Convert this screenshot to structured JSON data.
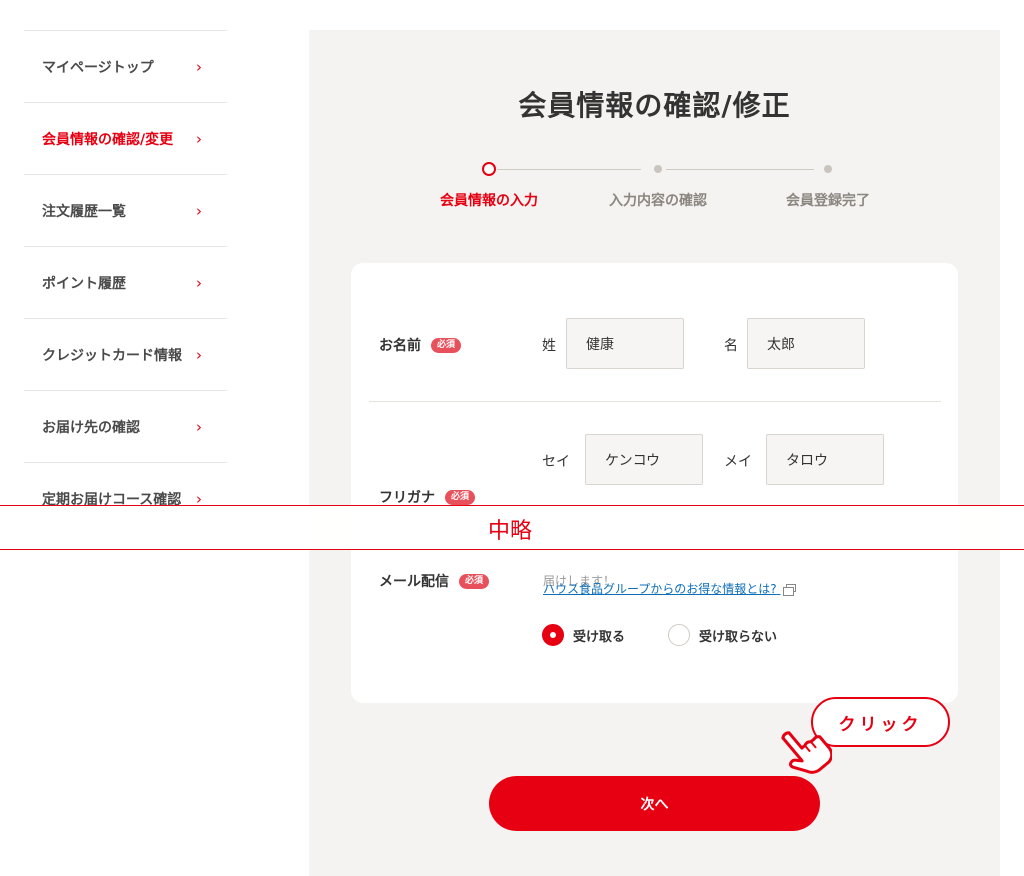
{
  "sidebar": {
    "items": [
      {
        "label": "マイページトップ",
        "active": false
      },
      {
        "label": "会員情報の確認/変更",
        "active": true
      },
      {
        "label": "注文履歴一覧",
        "active": false
      },
      {
        "label": "ポイント履歴",
        "active": false
      },
      {
        "label": "クレジットカード情報",
        "active": false
      },
      {
        "label": "お届け先の確認",
        "active": false
      },
      {
        "label": "定期お届けコース確認",
        "active": false
      }
    ],
    "chevron": "›"
  },
  "main": {
    "title": "会員情報の確認/修正",
    "steps": [
      {
        "label": "会員情報の入力",
        "current": true
      },
      {
        "label": "入力内容の確認",
        "current": false
      },
      {
        "label": "会員登録完了",
        "current": false
      }
    ]
  },
  "form": {
    "required_badge": "必須",
    "name": {
      "label": "お名前",
      "last_label": "姓",
      "last_value": "健康",
      "first_label": "名",
      "first_value": "太郎"
    },
    "kana": {
      "label": "フリガナ",
      "last_label": "セイ",
      "last_value": "ケンコウ",
      "first_label": "メイ",
      "first_value": "タロウ"
    },
    "mail": {
      "label": "メール配信",
      "partial_text": "届けします！",
      "info_link": "ハウス食品グループからのお得な情報とは?",
      "options": [
        {
          "label": "受け取る",
          "checked": true
        },
        {
          "label": "受け取らない",
          "checked": false
        }
      ]
    }
  },
  "omitted_label": "中略",
  "next_button": "次へ",
  "annotation": {
    "click_label": "クリック"
  },
  "colors": {
    "accent": "#e60012",
    "panel_bg": "#f4f3f1",
    "link": "#0d6eb8"
  }
}
